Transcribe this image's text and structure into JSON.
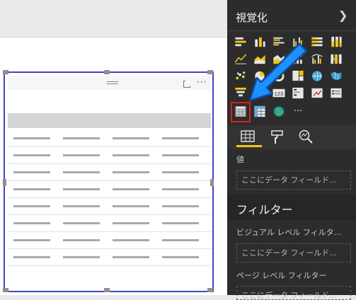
{
  "pane": {
    "title": "視覚化",
    "collapse_icon": "chevron-right-icon",
    "visual_icons": [
      "stacked-bar-chart-icon",
      "stacked-column-chart-icon",
      "clustered-bar-chart-icon",
      "clustered-column-chart-icon",
      "100-percent-bar-chart-icon",
      "100-percent-column-chart-icon",
      "line-chart-icon",
      "area-chart-icon",
      "stacked-area-chart-icon",
      "line-column-chart-icon",
      "line-clustered-column-chart-icon",
      "ribbon-chart-icon",
      "scatter-chart-icon",
      "pie-chart-icon",
      "donut-chart-icon",
      "treemap-icon",
      "map-icon",
      "filled-map-icon",
      "funnel-icon",
      "gauge-icon",
      "card-icon",
      "multi-row-card-icon",
      "kpi-icon",
      "slicer-icon",
      "table-icon",
      "matrix-icon",
      "arcgis-map-icon",
      "more-visuals-icon"
    ],
    "card_text": "123",
    "more_label": "···",
    "selected_visual": "table-icon",
    "tabs": [
      "fields-tab-icon",
      "format-roller-icon",
      "analytics-magnifier-icon"
    ],
    "values_label": "値",
    "drop_placeholder": "ここにデータ フィールド...",
    "filters_title": "フィルター",
    "visual_level_filters": "ビジュアル レベル フィルタ...",
    "visual_filter_placeholder": "ここにデータ フィールド...",
    "page_level_filters": "ページ レベル フィルター",
    "page_filter_placeholder": "ここにデータ フィールド..."
  },
  "visual": {
    "more_options": "···",
    "focus_icon": "focus-mode-icon"
  },
  "annotation": {
    "arrow_color": "#1e90ff",
    "highlight_color": "#e21c1c"
  }
}
